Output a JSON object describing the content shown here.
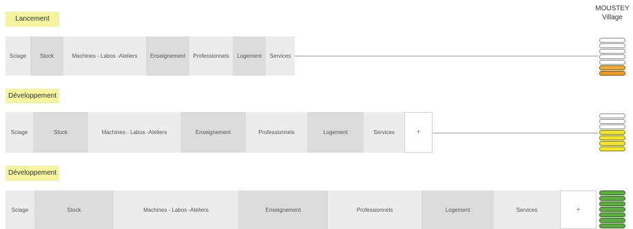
{
  "village": {
    "name": "MOUSTEY",
    "type": "Village"
  },
  "phases": [
    {
      "label": "Lancement",
      "segments": [
        "Sciage",
        "Stock",
        "Machines - Labos -Ateliers",
        "Enseignement",
        "Professionnels",
        "Logement",
        "Services"
      ],
      "indicator": [
        "#ffffff",
        "#ffffff",
        "#ffffff",
        "#ffffff",
        "#ffffff",
        "#f2ab36",
        "#ec9c24"
      ]
    },
    {
      "label": "Développement",
      "segments": [
        "Sciage",
        "Stock",
        "Machines - Labos -Ateliers",
        "Enseignement",
        "Professionnels",
        "Logement",
        "Services"
      ],
      "extra": "+",
      "indicator": [
        "#ffffff",
        "#ffffff",
        "#ffffff",
        "#f3e52c",
        "#f3e52c",
        "#f3e52c",
        "#f3e52c"
      ]
    },
    {
      "label": "Développement",
      "segments": [
        "Sciage",
        "Stock",
        "Machines - Labos -Ateliers",
        "Enseignement",
        "Professionnels",
        "Logement",
        "Services"
      ],
      "extra": "+",
      "indicator": [
        "#5cae3e",
        "#5cae3e",
        "#5cae3e",
        "#5cae3e",
        "#5cae3e",
        "#5cae3e",
        "#5cae3e"
      ]
    }
  ]
}
